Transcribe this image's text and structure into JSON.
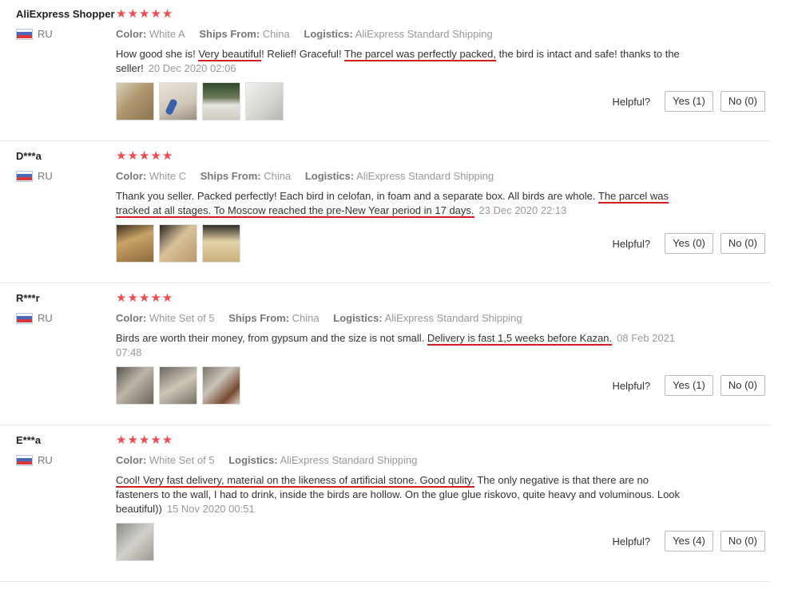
{
  "helpful_label": "Helpful?",
  "colors": {
    "star": "#f24a51",
    "underline": "#d22020"
  },
  "reviews": [
    {
      "name": "AliExpress Shopper",
      "country": "RU",
      "rating": "★★★★★",
      "attrs": [
        {
          "label": "Color:",
          "value": "White A"
        },
        {
          "label": "Ships From:",
          "value": "China"
        },
        {
          "label": "Logistics:",
          "value": "AliExpress Standard Shipping"
        }
      ],
      "text": [
        "How good she is! ",
        "Very beautiful",
        "! Relief! Graceful! ",
        "The parcel was perfectly packed,",
        " the bird is intact and safe! thanks to the seller!"
      ],
      "date": "20 Dec 2020 02:06",
      "yes": "Yes (1)",
      "no": "No (0)"
    },
    {
      "name": "D***a",
      "country": "RU",
      "rating": "★★★★★",
      "attrs": [
        {
          "label": "Color:",
          "value": "White C"
        },
        {
          "label": "Ships From:",
          "value": "China"
        },
        {
          "label": "Logistics:",
          "value": "AliExpress Standard Shipping"
        }
      ],
      "text": [
        "Thank you seller. Packed perfectly! Each bird in celofan, in foam and a separate box. All birds are whole. ",
        "The parcel was tracked at all stages. To Moscow reached the pre-New Year period in 17 days."
      ],
      "date": "23 Dec 2020 22:13",
      "yes": "Yes (0)",
      "no": "No (0)"
    },
    {
      "name": "R***r",
      "country": "RU",
      "rating": "★★★★★",
      "attrs": [
        {
          "label": "Color:",
          "value": "White Set of 5"
        },
        {
          "label": "Ships From:",
          "value": "China"
        },
        {
          "label": "Logistics:",
          "value": "AliExpress Standard Shipping"
        }
      ],
      "text": [
        "Birds are worth their money, from gypsum and the size is not small. ",
        "Delivery is fast 1,5 weeks before Kazan."
      ],
      "date": "08 Feb 2021 07:48",
      "yes": "Yes (1)",
      "no": "No (0)"
    },
    {
      "name": "E***a",
      "country": "RU",
      "rating": "★★★★★",
      "attrs": [
        {
          "label": "Color:",
          "value": "White Set of 5"
        },
        {
          "label": "Logistics:",
          "value": "AliExpress Standard Shipping"
        }
      ],
      "text": [
        "Cool! Very fast delivery, material on the likeness of artificial stone. Good qulity.",
        " The only negative is that there are no fasteners to the wall, I had to drink, inside the birds are hollow. On the glue glue riskovo, quite heavy and voluminous. Look beautiful))"
      ],
      "date": "15 Nov 2020 00:51",
      "yes": "Yes (4)",
      "no": "No (0)"
    }
  ]
}
